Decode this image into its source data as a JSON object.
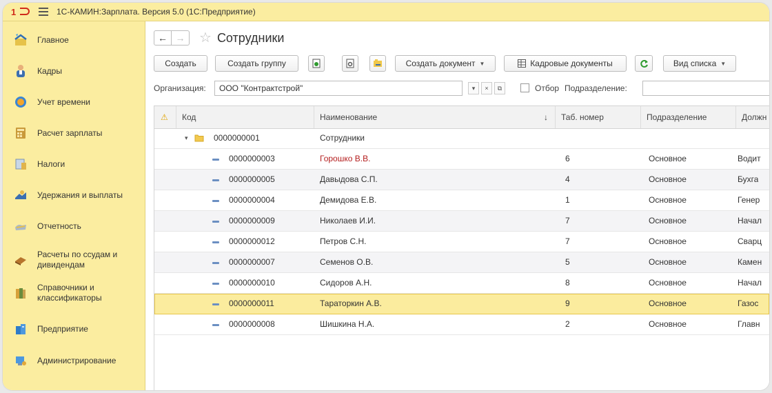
{
  "app": {
    "title": "1С-КАМИН:Зарплата. Версия 5.0  (1С:Предприятие)"
  },
  "sidebar": {
    "items": [
      {
        "label": "Главное",
        "icon": "home-icon"
      },
      {
        "label": "Кадры",
        "icon": "people-icon"
      },
      {
        "label": "Учет времени",
        "icon": "clock-icon"
      },
      {
        "label": "Расчет зарплаты",
        "icon": "calculator-icon"
      },
      {
        "label": "Налоги",
        "icon": "taxes-icon"
      },
      {
        "label": "Удержания и выплаты",
        "icon": "payments-icon"
      },
      {
        "label": "Отчетность",
        "icon": "reports-icon"
      },
      {
        "label": "Расчеты по ссудам и дивидендам",
        "icon": "loans-icon"
      },
      {
        "label": "Справочники и классификаторы",
        "icon": "books-icon"
      },
      {
        "label": "Предприятие",
        "icon": "enterprise-icon"
      },
      {
        "label": "Администрирование",
        "icon": "admin-icon"
      }
    ]
  },
  "header": {
    "back": "←",
    "forward": "→",
    "star": "☆",
    "title": "Сотрудники"
  },
  "toolbar": {
    "create": "Создать",
    "create_group": "Создать группу",
    "create_document": "Создать документ",
    "hr_documents": "Кадровые документы",
    "list_view": "Вид списка",
    "caret": "▼"
  },
  "filter": {
    "org_label": "Организация:",
    "org_value": "ООО \"Контрактстрой\"",
    "select_glyph": "▾",
    "clear_glyph": "×",
    "open_glyph": "⧉",
    "selection_label": "Отбор",
    "subdivision_label": "Подразделение:",
    "subdivision_value": ""
  },
  "table": {
    "columns": {
      "warn": "⚠",
      "code": "Код",
      "name": "Наименование",
      "sort": "↓",
      "tab": "Таб. номер",
      "dept": "Подразделение",
      "pos": "Должн"
    },
    "group": {
      "expand": "▾",
      "code": "0000000001",
      "name": "Сотрудники"
    },
    "rows": [
      {
        "code": "0000000003",
        "name": "Горошко В.В.",
        "tab": "6",
        "dept": "Основное",
        "pos": "Водит"
      },
      {
        "code": "0000000005",
        "name": "Давыдова С.П.",
        "tab": "4",
        "dept": "Основное",
        "pos": "Бухга"
      },
      {
        "code": "0000000004",
        "name": "Демидова Е.В.",
        "tab": "1",
        "dept": "Основное",
        "pos": "Генер"
      },
      {
        "code": "0000000009",
        "name": "Николаев И.И.",
        "tab": "7",
        "dept": "Основное",
        "pos": "Начал"
      },
      {
        "code": "0000000012",
        "name": "Петров С.Н.",
        "tab": "7",
        "dept": "Основное",
        "pos": "Сварц"
      },
      {
        "code": "0000000007",
        "name": "Семенов О.В.",
        "tab": "5",
        "dept": "Основное",
        "pos": "Камен"
      },
      {
        "code": "0000000010",
        "name": "Сидоров А.Н.",
        "tab": "8",
        "dept": "Основное",
        "pos": "Начал"
      },
      {
        "code": "0000000011",
        "name": "Тараторкин А.В.",
        "tab": "9",
        "dept": "Основное",
        "pos": "Газос"
      },
      {
        "code": "0000000008",
        "name": "Шишкина Н.А.",
        "tab": "2",
        "dept": "Основное",
        "pos": "Главн"
      }
    ]
  },
  "colors": {
    "accent": "#fbeda0",
    "selection": "#fbec9e",
    "highlight_text": "#b41e1e",
    "refresh": "#2e9a2e"
  }
}
